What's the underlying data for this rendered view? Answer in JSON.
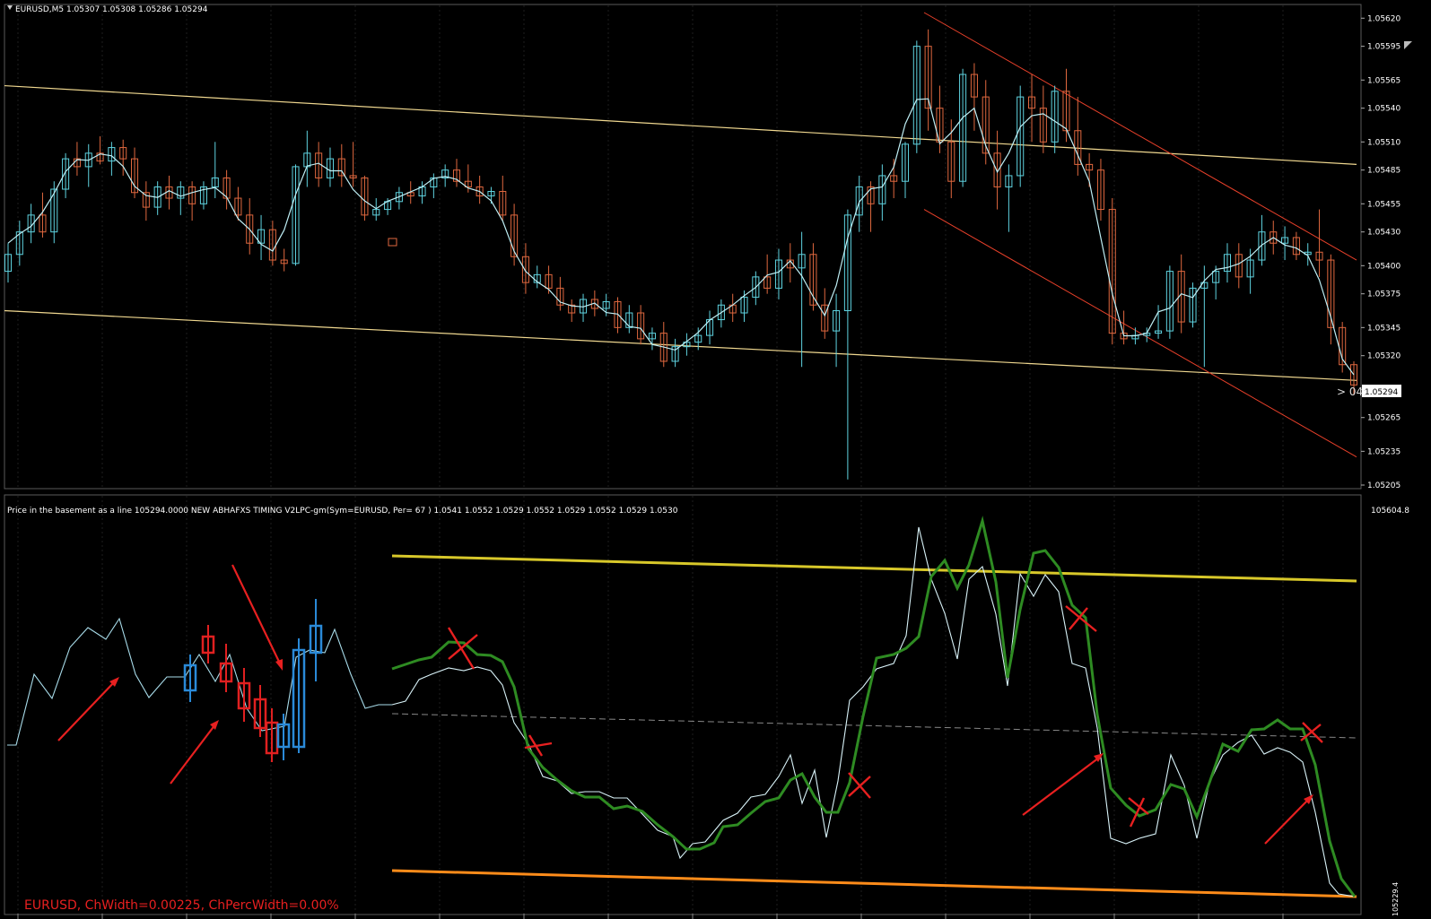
{
  "top_panel": {
    "header": "EURUSD,M5  1.05307 1.05308 1.05286 1.05294",
    "price_ticks": [
      "1.05620",
      "1.05595",
      "1.05565",
      "1.05540",
      "1.05510",
      "1.05485",
      "1.05455",
      "1.05430",
      "1.05400",
      "1.05375",
      "1.05345",
      "1.05320",
      "1.05290",
      "1.05265",
      "1.05235",
      "1.05205"
    ],
    "current_price": "1.05294",
    "countdown": "> 04:"
  },
  "bottom_panel": {
    "header": "Price in the basement as a line 105294.0000  NEW ABHAFXS TIMING V2LPC-gm(Sym=EURUSD, Per= 67 ) 1.0541 1.0552 1.0529 1.0552 1.0529 1.0552 1.0529 1.0530",
    "top_value": "105604.8",
    "bottom_value": "105229.4",
    "footer": "EURUSD, ChWidth=0.00225, ChPercWidth=0.00%"
  },
  "colors": {
    "background": "#000000",
    "bull": "#5fd3e0",
    "bear": "#e0683f",
    "ma_line": "#bfeff5",
    "channel": "#f0d890",
    "trend_channel": "#e8402a",
    "green_line": "#2e8b22",
    "upper_band": "#d8c82a",
    "lower_band": "#ff8c1a",
    "annotation": "#e82020",
    "demo_bull": "#2a8ad8",
    "demo_bear": "#e02020"
  },
  "chart_data": {
    "type": "candlestick",
    "symbol": "EURUSD",
    "timeframe": "M5",
    "ylim": [
      1.05205,
      1.05625
    ],
    "candles": [
      [
        1.05395,
        1.0542,
        1.05385,
        1.0541
      ],
      [
        1.0541,
        1.0544,
        1.054,
        1.0543
      ],
      [
        1.0543,
        1.05455,
        1.0542,
        1.05445
      ],
      [
        1.05445,
        1.05465,
        1.05425,
        1.0543
      ],
      [
        1.0543,
        1.05475,
        1.0542,
        1.05468
      ],
      [
        1.05468,
        1.055,
        1.0546,
        1.05495
      ],
      [
        1.05495,
        1.0551,
        1.0548,
        1.05488
      ],
      [
        1.05488,
        1.05508,
        1.0547,
        1.055
      ],
      [
        1.055,
        1.05515,
        1.0549,
        1.05493
      ],
      [
        1.05493,
        1.0551,
        1.0548,
        1.05505
      ],
      [
        1.05505,
        1.05512,
        1.0548,
        1.05495
      ],
      [
        1.05495,
        1.05505,
        1.0546,
        1.05465
      ],
      [
        1.05465,
        1.05475,
        1.0544,
        1.05452
      ],
      [
        1.05452,
        1.05475,
        1.05445,
        1.0547
      ],
      [
        1.0547,
        1.0548,
        1.0545,
        1.0546
      ],
      [
        1.0546,
        1.05475,
        1.05445,
        1.0547
      ],
      [
        1.0547,
        1.05475,
        1.0544,
        1.05455
      ],
      [
        1.05455,
        1.05475,
        1.0545,
        1.0547
      ],
      [
        1.0547,
        1.0551,
        1.0546,
        1.05478
      ],
      [
        1.05478,
        1.05485,
        1.0545,
        1.0546
      ],
      [
        1.0546,
        1.0547,
        1.0544,
        1.05445
      ],
      [
        1.05445,
        1.0546,
        1.0541,
        1.0542
      ],
      [
        1.0542,
        1.05445,
        1.05405,
        1.05432
      ],
      [
        1.05432,
        1.0544,
        1.054,
        1.05405
      ],
      [
        1.05405,
        1.05415,
        1.05395,
        1.05402
      ],
      [
        1.05402,
        1.0549,
        1.054,
        1.05488
      ],
      [
        1.05488,
        1.0552,
        1.0547,
        1.055
      ],
      [
        1.055,
        1.0551,
        1.0547,
        1.05478
      ],
      [
        1.05478,
        1.05505,
        1.0547,
        1.05495
      ],
      [
        1.05495,
        1.05508,
        1.0547,
        1.0548
      ],
      [
        1.0548,
        1.0551,
        1.0547,
        1.05478
      ],
      [
        1.05478,
        1.0548,
        1.0544,
        1.05445
      ],
      [
        1.05445,
        1.0546,
        1.0544,
        1.0545
      ],
      [
        1.0545,
        1.0546,
        1.05445,
        1.05457
      ],
      [
        1.05457,
        1.0547,
        1.0545,
        1.05465
      ],
      [
        1.05465,
        1.05475,
        1.05455,
        1.05462
      ],
      [
        1.05462,
        1.05475,
        1.05455,
        1.0547
      ],
      [
        1.0547,
        1.05482,
        1.0546,
        1.05478
      ],
      [
        1.05478,
        1.0549,
        1.0547,
        1.05485
      ],
      [
        1.05485,
        1.05495,
        1.0547,
        1.05475
      ],
      [
        1.05475,
        1.0549,
        1.05465,
        1.0547
      ],
      [
        1.0547,
        1.0548,
        1.05455,
        1.05462
      ],
      [
        1.05462,
        1.0547,
        1.05455,
        1.05466
      ],
      [
        1.05466,
        1.0548,
        1.0544,
        1.05445
      ],
      [
        1.05445,
        1.05455,
        1.054,
        1.05408
      ],
      [
        1.05408,
        1.0542,
        1.05375,
        1.05385
      ],
      [
        1.05385,
        1.054,
        1.0538,
        1.05392
      ],
      [
        1.05392,
        1.054,
        1.05375,
        1.0538
      ],
      [
        1.0538,
        1.0539,
        1.0536,
        1.05365
      ],
      [
        1.05365,
        1.0537,
        1.0535,
        1.05358
      ],
      [
        1.05358,
        1.05375,
        1.0535,
        1.0537
      ],
      [
        1.0537,
        1.05378,
        1.05355,
        1.05362
      ],
      [
        1.05362,
        1.05375,
        1.05355,
        1.05368
      ],
      [
        1.05368,
        1.05372,
        1.0534,
        1.05345
      ],
      [
        1.05345,
        1.05365,
        1.0534,
        1.05358
      ],
      [
        1.05358,
        1.05365,
        1.0533,
        1.05335
      ],
      [
        1.05335,
        1.05345,
        1.05325,
        1.0534
      ],
      [
        1.0534,
        1.0535,
        1.0531,
        1.05315
      ],
      [
        1.05315,
        1.05335,
        1.0531,
        1.05328
      ],
      [
        1.05328,
        1.0534,
        1.0532,
        1.05332
      ],
      [
        1.05332,
        1.05345,
        1.05325,
        1.05338
      ],
      [
        1.05338,
        1.0536,
        1.0533,
        1.05352
      ],
      [
        1.05352,
        1.0537,
        1.05345,
        1.05365
      ],
      [
        1.05365,
        1.05375,
        1.0535,
        1.05358
      ],
      [
        1.05358,
        1.05378,
        1.0535,
        1.05372
      ],
      [
        1.05372,
        1.05395,
        1.05365,
        1.0539
      ],
      [
        1.0539,
        1.0541,
        1.05375,
        1.0538
      ],
      [
        1.0538,
        1.05415,
        1.0537,
        1.05405
      ],
      [
        1.05405,
        1.0542,
        1.05385,
        1.05398
      ],
      [
        1.05398,
        1.0543,
        1.0531,
        1.0541
      ],
      [
        1.0541,
        1.0542,
        1.0536,
        1.05365
      ],
      [
        1.05365,
        1.0538,
        1.05335,
        1.05342
      ],
      [
        1.05342,
        1.05375,
        1.0531,
        1.0536
      ],
      [
        1.0536,
        1.0545,
        1.0521,
        1.05445
      ],
      [
        1.05445,
        1.0548,
        1.0543,
        1.0547
      ],
      [
        1.0547,
        1.05475,
        1.0543,
        1.05455
      ],
      [
        1.05455,
        1.0549,
        1.0544,
        1.0548
      ],
      [
        1.0548,
        1.05495,
        1.0546,
        1.05475
      ],
      [
        1.05475,
        1.0551,
        1.0546,
        1.05508
      ],
      [
        1.05508,
        1.056,
        1.055,
        1.05595
      ],
      [
        1.05595,
        1.0561,
        1.0552,
        1.0554
      ],
      [
        1.0554,
        1.0556,
        1.055,
        1.0551
      ],
      [
        1.0551,
        1.0553,
        1.0546,
        1.05475
      ],
      [
        1.05475,
        1.05575,
        1.0547,
        1.0557
      ],
      [
        1.0557,
        1.0558,
        1.0552,
        1.0555
      ],
      [
        1.0555,
        1.05565,
        1.0549,
        1.055
      ],
      [
        1.055,
        1.0552,
        1.0545,
        1.0547
      ],
      [
        1.0547,
        1.0549,
        1.0543,
        1.0548
      ],
      [
        1.0548,
        1.0556,
        1.0547,
        1.0555
      ],
      [
        1.0555,
        1.0557,
        1.0551,
        1.0554
      ],
      [
        1.0554,
        1.0556,
        1.055,
        1.0551
      ],
      [
        1.0551,
        1.0556,
        1.055,
        1.05555
      ],
      [
        1.05555,
        1.05575,
        1.0551,
        1.0552
      ],
      [
        1.0552,
        1.0555,
        1.0548,
        1.0549
      ],
      [
        1.0549,
        1.055,
        1.0547,
        1.05485
      ],
      [
        1.05485,
        1.05495,
        1.0544,
        1.0545
      ],
      [
        1.0545,
        1.0546,
        1.0533,
        1.0534
      ],
      [
        1.0534,
        1.0536,
        1.0533,
        1.05335
      ],
      [
        1.05335,
        1.05345,
        1.0533,
        1.05338
      ],
      [
        1.05338,
        1.05345,
        1.05332,
        1.0534
      ],
      [
        1.0534,
        1.05365,
        1.05335,
        1.05342
      ],
      [
        1.05342,
        1.054,
        1.05335,
        1.05395
      ],
      [
        1.05395,
        1.0541,
        1.0534,
        1.0535
      ],
      [
        1.0535,
        1.05385,
        1.05345,
        1.0538
      ],
      [
        1.0538,
        1.054,
        1.0531,
        1.05385
      ],
      [
        1.05385,
        1.054,
        1.0537,
        1.05395
      ],
      [
        1.05395,
        1.0542,
        1.05385,
        1.0541
      ],
      [
        1.0541,
        1.0542,
        1.0538,
        1.0539
      ],
      [
        1.0539,
        1.05415,
        1.05375,
        1.05405
      ],
      [
        1.05405,
        1.05445,
        1.054,
        1.0543
      ],
      [
        1.0543,
        1.0544,
        1.0541,
        1.0542
      ],
      [
        1.0542,
        1.05435,
        1.05405,
        1.05425
      ],
      [
        1.05425,
        1.0543,
        1.05405,
        1.0541
      ],
      [
        1.0541,
        1.0542,
        1.054,
        1.05412
      ],
      [
        1.05412,
        1.0545,
        1.0539,
        1.05405
      ],
      [
        1.05405,
        1.0541,
        1.0533,
        1.05345
      ],
      [
        1.05345,
        1.0535,
        1.05305,
        1.05312
      ],
      [
        1.05312,
        1.05315,
        1.05285,
        1.05294
      ]
    ]
  }
}
